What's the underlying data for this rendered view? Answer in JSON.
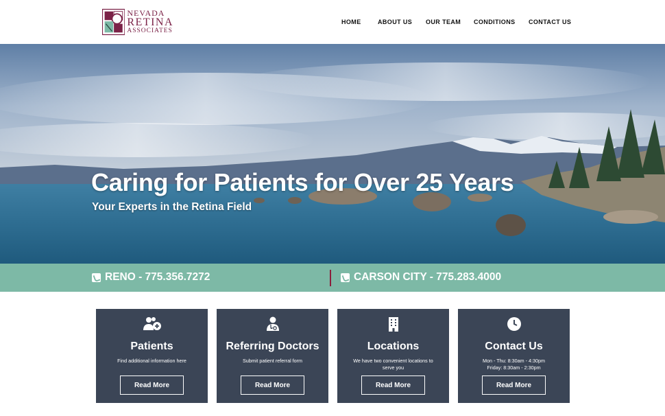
{
  "brand": {
    "line1": "NEVADA",
    "line2": "RETINA",
    "line3": "ASSOCIATES",
    "color": "#7b2247"
  },
  "nav": {
    "items": [
      {
        "label": "HOME"
      },
      {
        "label": "ABOUT US"
      },
      {
        "label": "OUR TEAM"
      },
      {
        "label": "CONDITIONS"
      },
      {
        "label": "CONTACT US"
      }
    ]
  },
  "hero": {
    "title": "Caring for Patients for Over 25 Years",
    "subtitle": "Your Experts in the Retina Field"
  },
  "phones": {
    "reno": "RENO - 775.356.7272",
    "carson": "CARSON CITY - 775.283.4000",
    "bar_color": "#7db9a6",
    "divider_color": "#8b1d3c"
  },
  "cards": [
    {
      "icon": "patients-icon",
      "title": "Patients",
      "desc1": "Find additional information here",
      "desc2": "",
      "button": "Read More"
    },
    {
      "icon": "doctor-icon",
      "title": "Referring Doctors",
      "desc1": "Submit patient referral form",
      "desc2": "",
      "button": "Read More"
    },
    {
      "icon": "building-icon",
      "title": "Locations",
      "desc1": "We have two convenient locations to",
      "desc2": "serve you",
      "button": "Read More"
    },
    {
      "icon": "clock-icon",
      "title": "Contact Us",
      "desc1": "Mon - Thu: 8:30am - 4:30pm",
      "desc2": "Friday: 8:30am - 2:30pm",
      "button": "Read More"
    }
  ],
  "card_color": "#3b4556"
}
